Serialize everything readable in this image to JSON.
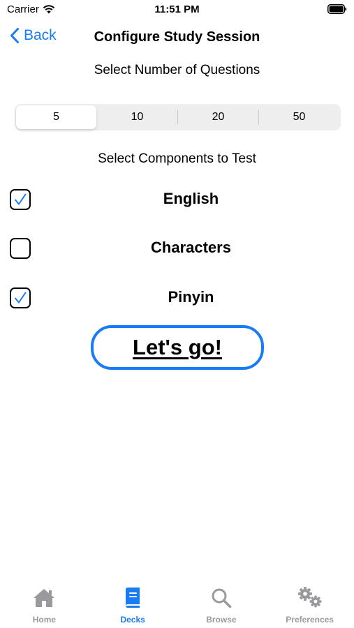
{
  "status_bar": {
    "carrier": "Carrier",
    "time": "11:51 PM",
    "wifi_icon": "wifi-icon",
    "battery_icon": "battery-icon"
  },
  "nav": {
    "back_label": "Back",
    "title": "Configure Study Session"
  },
  "questions": {
    "label": "Select Number of Questions",
    "options": [
      "5",
      "10",
      "20",
      "50"
    ],
    "selected": "5"
  },
  "components": {
    "label": "Select Components to Test",
    "items": [
      {
        "label": "English",
        "checked": true
      },
      {
        "label": "Characters",
        "checked": false
      },
      {
        "label": "Pinyin",
        "checked": true
      }
    ]
  },
  "go_button": {
    "label": "Let's go!"
  },
  "tab_bar": {
    "tabs": [
      {
        "label": "Home",
        "icon": "house-icon",
        "active": false
      },
      {
        "label": "Decks",
        "icon": "book-icon",
        "active": true
      },
      {
        "label": "Browse",
        "icon": "magnifier-icon",
        "active": false
      },
      {
        "label": "Preferences",
        "icon": "gears-icon",
        "active": false
      }
    ]
  },
  "colors": {
    "accent": "#1a7cf5",
    "inactive_tab": "#9a9a9e",
    "segment_bg": "#eeeeef"
  }
}
